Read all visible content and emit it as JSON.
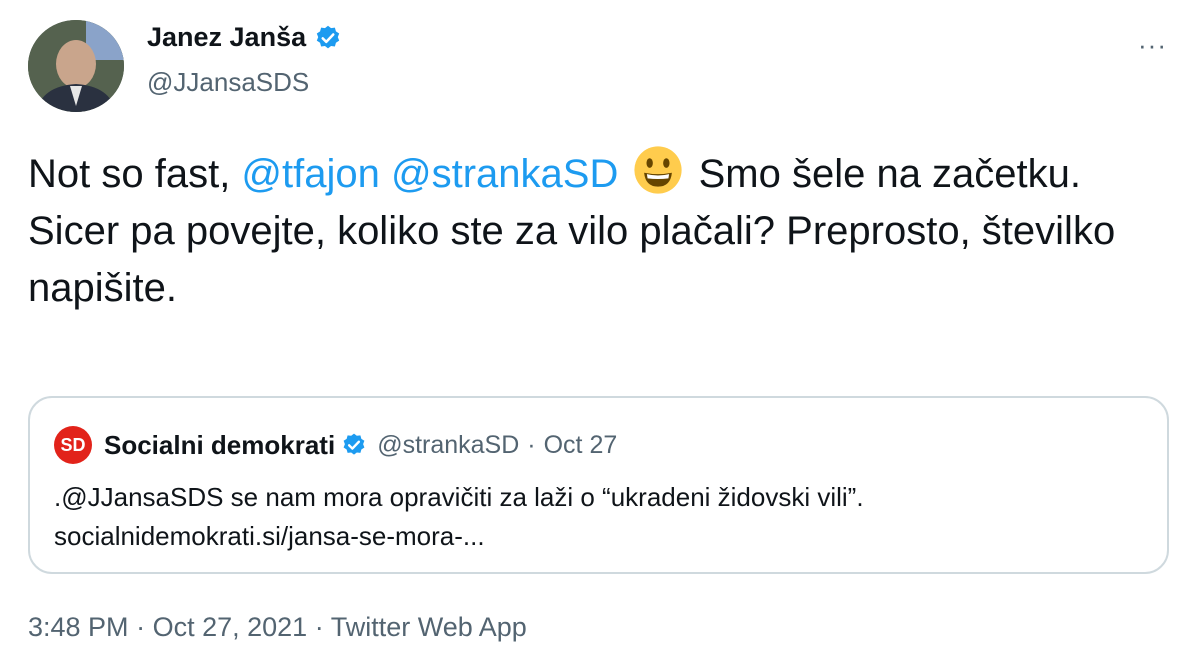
{
  "author": {
    "display_name": "Janez Janša",
    "handle": "@JJansaSDS",
    "verified": true
  },
  "more_menu_glyph": "···",
  "tweet": {
    "prefix": "Not so fast, ",
    "mention_1": "@tfajon",
    "mention_2": "@strankaSD",
    "emoji": "grinning-face",
    "after_emoji": " Smo šele na začetku.",
    "line_2": "Sicer pa povejte, koliko ste za vilo plačali? Preprosto, številko napišite."
  },
  "quoted_tweet": {
    "avatar_text": "SD",
    "display_name": "Socialni demokrati",
    "verified": true,
    "handle": "@strankaSD",
    "separator": "·",
    "date": "Oct 27",
    "text": ".@JJansaSDS se nam mora opravičiti za laži o “ukradeni židovski vili”.",
    "link": "socialnidemokrati.si/jansa-se-mora-..."
  },
  "footer": {
    "time": "3:48 PM",
    "separator": "·",
    "date": "Oct 27, 2021",
    "source": "Twitter Web App"
  },
  "colors": {
    "link": "#1d9bf0",
    "secondary_text": "#536471",
    "sd_red": "#e2231a",
    "border": "#cfd9de"
  }
}
